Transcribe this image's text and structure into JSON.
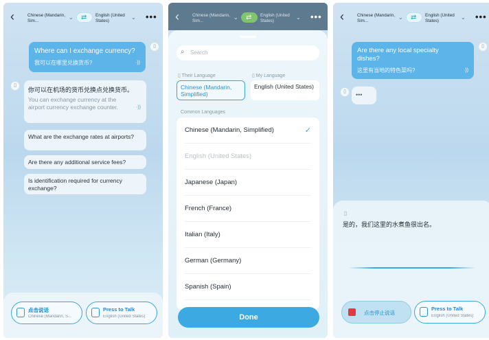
{
  "colors": {
    "accent": "#3aa6df",
    "user_bubble": "#5db4e8",
    "stop_red": "#e03b45"
  },
  "topbar": {
    "their_language": "Chinese (Mandarin, Sim...",
    "their_language_short": "Chinese (Mandarin, Sim...",
    "my_language": "English (United States)",
    "more_label": "•••",
    "back_label": "‹",
    "swap_label": "⇄"
  },
  "screen1": {
    "user_bubble": {
      "en": "Where can I exchange currency?",
      "zh": "我可以在哪里兑换货币?"
    },
    "reply_bubble": {
      "zh": "你可以在机场的货币兑换点兑换货币。",
      "en": "You can exchange currency at the airport currency exchange counter."
    },
    "suggestions": [
      "What are the exchange rates at airports?",
      "Are there any additional service fees?",
      "Is identification required for currency exchange?"
    ],
    "bottom": {
      "left_title": "点击说话",
      "left_sub": "Chinese (Mandarin, S...",
      "right_title": "Press to Talk",
      "right_sub": "English (United States)"
    }
  },
  "screen2": {
    "search_placeholder": "Search",
    "their_language_header": "Their Language",
    "my_language_header": "My Language",
    "their_language_value": "Chinese (Mandarin, Simplified)",
    "my_language_value": "English (United States)",
    "common_header": "Common Languages",
    "languages": [
      {
        "label": "Chinese (Mandarin, Simplified)",
        "selected": true,
        "disabled": false
      },
      {
        "label": "English (United States)",
        "selected": false,
        "disabled": true
      },
      {
        "label": "Japanese (Japan)",
        "selected": false,
        "disabled": false
      },
      {
        "label": "French (France)",
        "selected": false,
        "disabled": false
      },
      {
        "label": "Italian (Italy)",
        "selected": false,
        "disabled": false
      },
      {
        "label": "German (Germany)",
        "selected": false,
        "disabled": false
      },
      {
        "label": "Spanish (Spain)",
        "selected": false,
        "disabled": false
      }
    ],
    "done_label": "Done"
  },
  "screen3": {
    "user_bubble": {
      "en": "Are there any local specialty dishes?",
      "zh": "这里有当地的特色菜吗?"
    },
    "typing": "•••",
    "live_text": "是的，我们这里的水煮鱼很出名。",
    "bottom": {
      "stop_label": "点击停止说话",
      "right_title": "Press to Talk",
      "right_sub": "English (United States)"
    }
  },
  "icons": {
    "search": "search-icon",
    "check": "✓",
    "speaker": "·))"
  }
}
